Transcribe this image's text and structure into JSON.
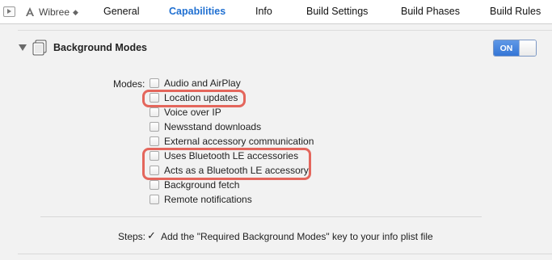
{
  "tabbar": {
    "target_name": "Wibree",
    "target_stepper": "◆",
    "tabs": [
      {
        "label": "General",
        "active": false
      },
      {
        "label": "Capabilities",
        "active": true
      },
      {
        "label": "Info",
        "active": false
      },
      {
        "label": "Build Settings",
        "active": false
      },
      {
        "label": "Build Phases",
        "active": false
      },
      {
        "label": "Build Rules",
        "active": false
      }
    ]
  },
  "section": {
    "title": "Background Modes",
    "toggle_label": "ON",
    "toggle_on": true
  },
  "modes": {
    "label": "Modes:",
    "items": [
      {
        "label": "Audio and AirPlay",
        "checked": false,
        "highlighted": false
      },
      {
        "label": "Location updates",
        "checked": false,
        "highlighted": true
      },
      {
        "label": "Voice over IP",
        "checked": false,
        "highlighted": false
      },
      {
        "label": "Newsstand downloads",
        "checked": false,
        "highlighted": false
      },
      {
        "label": "External accessory communication",
        "checked": false,
        "highlighted": false
      },
      {
        "label": "Uses Bluetooth LE accessories",
        "checked": false,
        "highlighted": true
      },
      {
        "label": "Acts as a Bluetooth LE accessory",
        "checked": false,
        "highlighted": true
      },
      {
        "label": "Background fetch",
        "checked": false,
        "highlighted": false
      },
      {
        "label": "Remote notifications",
        "checked": false,
        "highlighted": false
      }
    ]
  },
  "steps": {
    "label": "Steps:",
    "check": "✓",
    "text": "Add the \"Required Background Modes\" key to your info plist file"
  },
  "colors": {
    "accent": "#1f6fd1",
    "highlight": "#e4665c"
  }
}
